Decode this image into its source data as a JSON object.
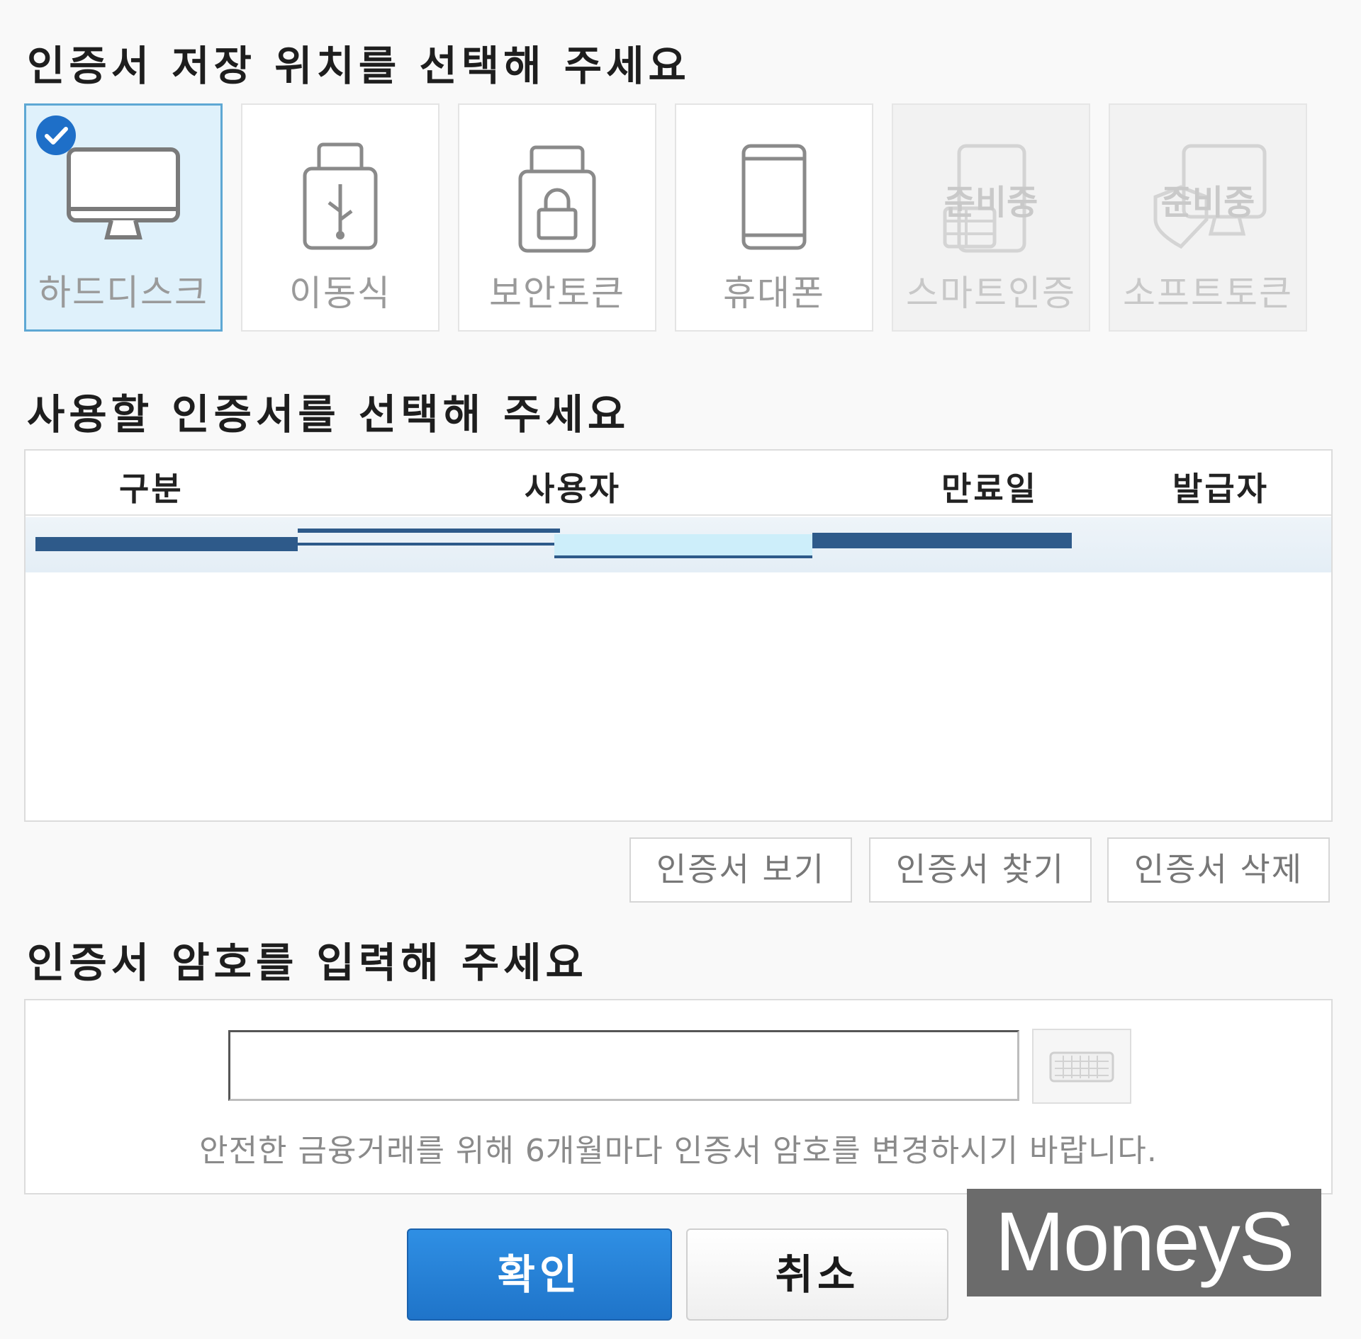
{
  "sections": {
    "storage_title": "인증서 저장 위치를 선택해 주세요",
    "cert_title": "사용할 인증서를 선택해 주세요",
    "password_title": "인증서 암호를 입력해 주세요"
  },
  "storage_options": [
    {
      "label": "하드디스크",
      "icon": "monitor-icon",
      "state": "selected"
    },
    {
      "label": "이동식",
      "icon": "usb-icon",
      "state": "enabled"
    },
    {
      "label": "보안토큰",
      "icon": "lock-token-icon",
      "state": "enabled"
    },
    {
      "label": "휴대폰",
      "icon": "phone-icon",
      "state": "enabled"
    },
    {
      "label": "스마트인증",
      "icon": "smart-card-icon",
      "state": "disabled",
      "badge": "준비중"
    },
    {
      "label": "소프트토큰",
      "icon": "soft-token-icon",
      "state": "disabled",
      "badge": "준비중"
    }
  ],
  "cert_table": {
    "columns": [
      "구분",
      "사용자",
      "만료일",
      "발급자"
    ]
  },
  "cert_actions": {
    "view": "인증서 보기",
    "find": "인증서 찾기",
    "delete": "인증서 삭제"
  },
  "password": {
    "value": "",
    "notice": "안전한 금융거래를 위해 6개월마다 인증서 암호를 변경하시기 바랍니다."
  },
  "footer": {
    "ok": "확인",
    "cancel": "취소"
  },
  "watermark": "MoneyS",
  "colors": {
    "accent": "#1f74c9",
    "selected_tile": "#dff1fb",
    "selected_border": "#5ea8d4",
    "redaction": "#2e5a8a"
  }
}
